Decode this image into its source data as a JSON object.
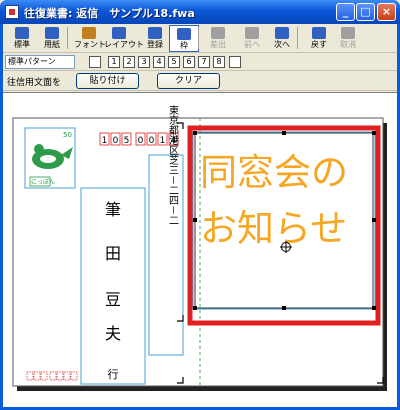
{
  "window": {
    "title": "往復業書: 返信　サンプル18.fwa",
    "min": "_",
    "max": "□",
    "close": "×"
  },
  "toolbar": {
    "buttons": [
      {
        "label": "標準",
        "icon": "standard-icon"
      },
      {
        "label": "用紙",
        "icon": "paper-icon"
      },
      {
        "label": "フォント",
        "icon": "font-icon"
      },
      {
        "label": "レイアウト",
        "icon": "layout-icon"
      },
      {
        "label": "登録",
        "icon": "register-icon"
      },
      {
        "label": "枠",
        "icon": "frame-icon",
        "selected": true
      },
      {
        "label": "差出",
        "icon": "sender-icon",
        "disabled": true
      },
      {
        "label": "前へ",
        "icon": "prev-icon",
        "disabled": true
      },
      {
        "label": "次へ",
        "icon": "next-icon"
      },
      {
        "label": "戻す",
        "icon": "undo-icon"
      },
      {
        "label": "取消",
        "icon": "cancel-icon",
        "disabled": true
      }
    ]
  },
  "pattern": {
    "value": "標準パターン",
    "numbers": [
      "1",
      "2",
      "3",
      "4",
      "5",
      "6",
      "7",
      "8"
    ]
  },
  "reply_text": {
    "label": "往信用文面を",
    "paste": "貼り付け",
    "clear": "クリア"
  },
  "card": {
    "postal_code": [
      "1",
      "0",
      "5",
      "0",
      "0",
      "1",
      "4"
    ],
    "address": "東京都港区芝三－二四－二",
    "name_line1": "筆",
    "name_line2": "田",
    "name_line3": "豆",
    "name_line4": "夫",
    "honorific": "行",
    "stamp_value": "50",
    "stamp_label": "にっぽん",
    "message_line1": "同窓会の",
    "message_line2": "お知らせ",
    "colors": {
      "accent": "#f5a623",
      "frame": "#e02020",
      "card": "#4aa0d8"
    }
  }
}
